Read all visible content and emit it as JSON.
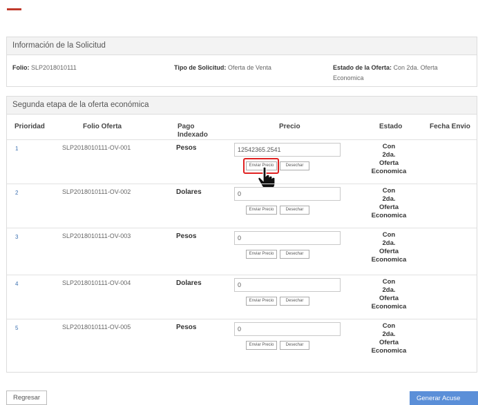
{
  "info": {
    "title": "Información de la Solicitud",
    "folio_label": "Folio:",
    "folio_value": "SLP2018010111",
    "tipo_label": "Tipo de Solicitud:",
    "tipo_value": "Oferta de Venta",
    "estado_label": "Estado de la Oferta:",
    "estado_value_1": "Con 2da. Oferta",
    "estado_value_2": "Economica"
  },
  "etapa": {
    "title": "Segunda etapa de la oferta económica",
    "headers": {
      "prioridad": "Prioridad",
      "folio": "Folio Oferta",
      "pago_1": "Pago",
      "pago_2": "Indexado",
      "precio": "Precio",
      "estado": "Estado",
      "fecha": "Fecha Envio"
    },
    "rows": [
      {
        "prioridad": "1",
        "folio": "SLP2018010111-OV-001",
        "pago": "Pesos",
        "precio": "12542365.2541",
        "estado": [
          "Con",
          "2da.",
          "Oferta",
          "Economica"
        ],
        "fecha": ""
      },
      {
        "prioridad": "2",
        "folio": "SLP2018010111-OV-002",
        "pago": "Dolares",
        "precio": "0",
        "estado": [
          "Con",
          "2da.",
          "Oferta",
          "Economica"
        ],
        "fecha": ""
      },
      {
        "prioridad": "3",
        "folio": "SLP2018010111-OV-003",
        "pago": "Pesos",
        "precio": "0",
        "estado": [
          "Con",
          "2da.",
          "Oferta",
          "Economica"
        ],
        "fecha": ""
      },
      {
        "prioridad": "4",
        "folio": "SLP2018010111-OV-004",
        "pago": "Dolares",
        "precio": "0",
        "estado": [
          "Con",
          "2da.",
          "Oferta",
          "Economica"
        ],
        "fecha": ""
      },
      {
        "prioridad": "5",
        "folio": "SLP2018010111-OV-005",
        "pago": "Pesos",
        "precio": "0",
        "estado": [
          "Con",
          "2da.",
          "Oferta",
          "Economica"
        ],
        "fecha": ""
      }
    ],
    "btn_enviar": "Enviar Precio",
    "btn_desechar": "Desechar"
  },
  "footer": {
    "regresar": "Regresar",
    "generar": "Generar Acuse"
  },
  "colors": {
    "accent_red": "#c0392b",
    "link_blue": "#3a6fb0",
    "primary_button": "#5b8fd8",
    "highlight": "#e02020"
  },
  "icons": [
    "hand-pointer-icon"
  ]
}
